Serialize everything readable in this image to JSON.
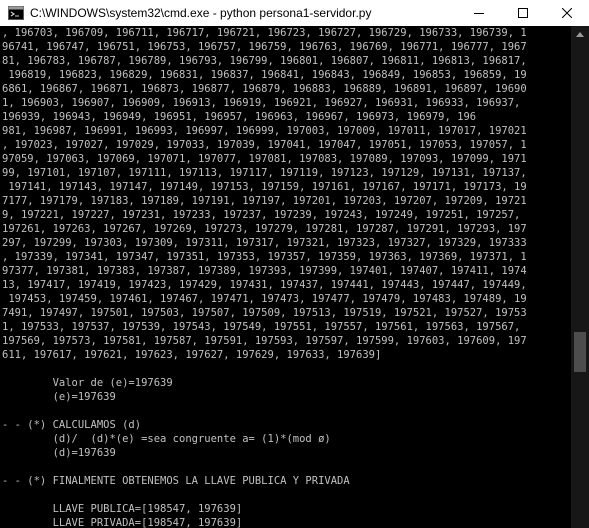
{
  "window": {
    "title": "C:\\WINDOWS\\system32\\cmd.exe - python  persona1-servidor.py"
  },
  "console": {
    "lines": [
      ", 196703, 196709, 196711, 196717, 196721, 196723, 196727, 196729, 196733, 196739, 1",
      "96741, 196747, 196751, 196753, 196757, 196759, 196763, 196769, 196771, 196777, 1967",
      "81, 196783, 196787, 196789, 196793, 196799, 196801, 196807, 196811, 196813, 196817,",
      " 196819, 196823, 196829, 196831, 196837, 196841, 196843, 196849, 196853, 196859, 19",
      "6861, 196867, 196871, 196873, 196877, 196879, 196883, 196889, 196891, 196897, 19690",
      "1, 196903, 196907, 196909, 196913, 196919, 196921, 196927, 196931, 196933, 196937, ",
      "196939, 196943, 196949, 196951, 196957, 196963, 196967, 196973, 196979, 196",
      "981, 196987, 196991, 196993, 196997, 196999, 197003, 197009, 197011, 197017, 197021",
      ", 197023, 197027, 197029, 197033, 197039, 197041, 197047, 197051, 197053, 197057, 1",
      "97059, 197063, 197069, 197071, 197077, 197081, 197083, 197089, 197093, 197099, 1971",
      "99, 197101, 197107, 197111, 197113, 197117, 197119, 197123, 197129, 197131, 197137,",
      " 197141, 197143, 197147, 197149, 197153, 197159, 197161, 197167, 197171, 197173, 19",
      "7177, 197179, 197183, 197189, 197191, 197197, 197201, 197203, 197207, 197209, 19721",
      "9, 197221, 197227, 197231, 197233, 197237, 197239, 197243, 197249, 197251, 197257, ",
      "197261, 197263, 197267, 197269, 197273, 197279, 197281, 197287, 197291, 197293, 197",
      "297, 197299, 197303, 197309, 197311, 197317, 197321, 197323, 197327, 197329, 197333",
      ", 197339, 197341, 197347, 197351, 197353, 197357, 197359, 197363, 197369, 197371, 1",
      "97377, 197381, 197383, 197387, 197389, 197393, 197399, 197401, 197407, 197411, 1974",
      "13, 197417, 197419, 197423, 197429, 197431, 197437, 197441, 197443, 197447, 197449,",
      " 197453, 197459, 197461, 197467, 197471, 197473, 197477, 197479, 197483, 197489, 19",
      "7491, 197497, 197501, 197503, 197507, 197509, 197513, 197519, 197521, 197527, 19753",
      "1, 197533, 197537, 197539, 197543, 197549, 197551, 197557, 197561, 197563, 197567, ",
      "197569, 197573, 197581, 197587, 197591, 197593, 197597, 197599, 197603, 197609, 197",
      "611, 197617, 197621, 197623, 197627, 197629, 197633, 197639]",
      "",
      "        Valor de (e)=197639",
      "        (e)=197639",
      "",
      "- - (*) CALCULAMOS (d)",
      "        (d)/  (d)*(e) =sea congruente a= (1)*(mod ø)",
      "        (d)=197639",
      "",
      "- - (*) FINALMENTE OBTENEMOS LA LLAVE PUBLICA Y PRIVADA",
      "",
      "        LLAVE PUBLICA=[198547, 197639]",
      "        LLAVE PRIVADA=[198547, 197639]"
    ]
  },
  "colors": {
    "console_bg": "#000000",
    "console_text": "#c0c0c0",
    "titlebar_bg": "#ffffff",
    "scrollbar_track": "#171717",
    "scrollbar_thumb": "#4d4d4d"
  },
  "icons": {
    "app": "cmd-icon",
    "minimize": "minimize-icon",
    "maximize": "maximize-icon",
    "close": "close-icon",
    "scroll_up": "chevron-up-icon"
  }
}
